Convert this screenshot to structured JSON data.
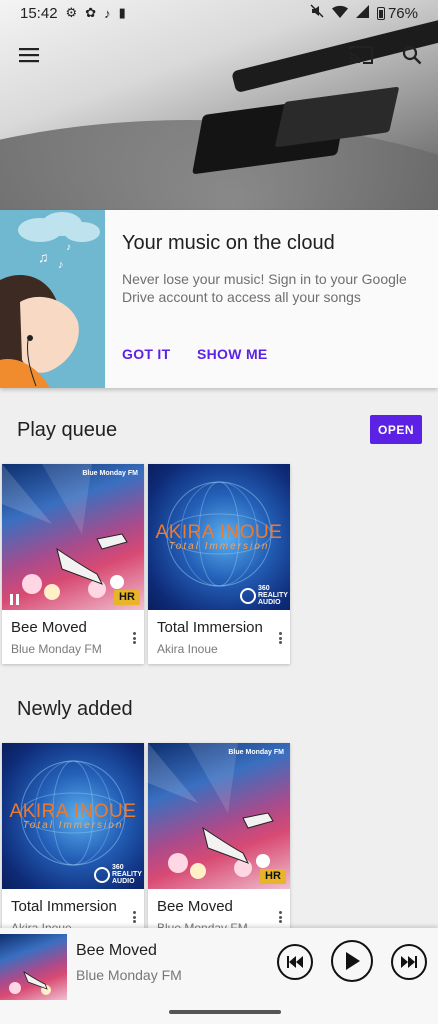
{
  "status_bar": {
    "time": "15:42",
    "battery": "76%",
    "icons": [
      "settings-icon",
      "app-icon",
      "music-note-icon",
      "sim-icon",
      "mute-icon",
      "wifi-icon",
      "signal-icon",
      "battery-icon"
    ]
  },
  "toolbar": {
    "icons": [
      "menu-icon",
      "cast-icon",
      "search-icon"
    ]
  },
  "cloud_card": {
    "title": "Your music on the cloud",
    "body": "Never lose your music! Sign in to your Google Drive account to access all your songs",
    "got_it_label": "GOT IT",
    "show_me_label": "SHOW ME",
    "accent_color": "#5b22e6"
  },
  "play_queue": {
    "title": "Play queue",
    "open_label": "OPEN",
    "items": [
      {
        "title": "Bee Moved",
        "subtitle": "Blue Monday FM",
        "art_label": "Blue Monday FM",
        "badge": "HR",
        "state": "paused"
      },
      {
        "title": "Total Immersion",
        "subtitle": "Akira Inoue",
        "art_name": "AKIRA INOUE",
        "art_sub": "Total Immersion",
        "badge": "360 REALITY AUDIO"
      }
    ]
  },
  "newly_added": {
    "title": "Newly added",
    "items": [
      {
        "title": "Total Immersion",
        "subtitle": "Akira Inoue",
        "art_name": "AKIRA INOUE",
        "art_sub": "Total Immersion",
        "badge": "360 REALITY AUDIO"
      },
      {
        "title": "Bee Moved",
        "subtitle": "Blue Monday FM",
        "art_label": "Blue Monday FM",
        "badge": "HR"
      }
    ]
  },
  "mini_player": {
    "title": "Bee Moved",
    "artist": "Blue Monday FM",
    "controls": [
      "previous-icon",
      "play-icon",
      "next-icon"
    ]
  }
}
